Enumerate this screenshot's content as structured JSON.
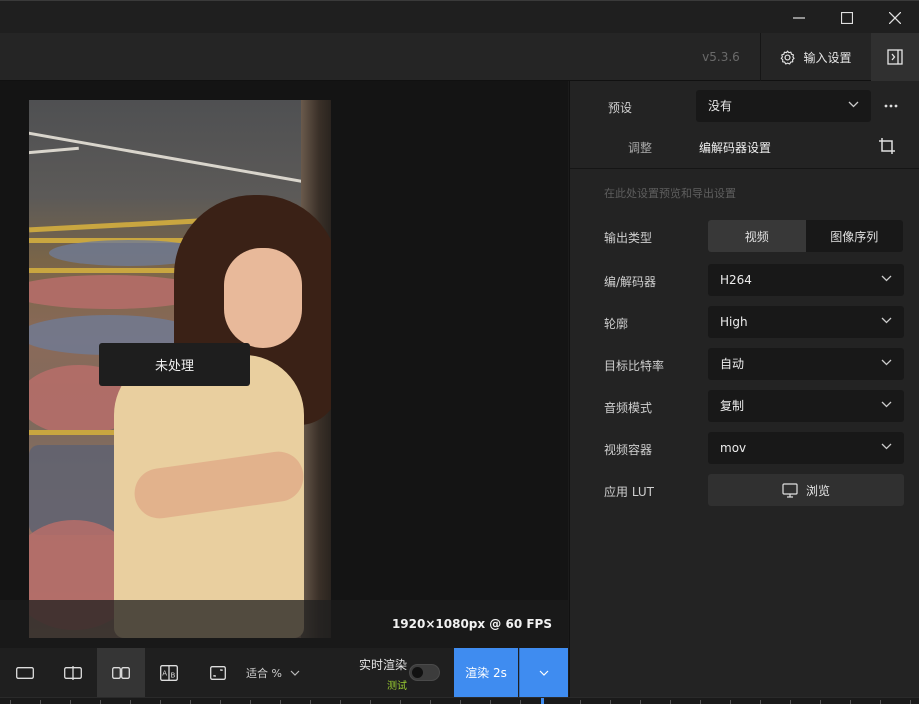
{
  "window": {
    "controls": [
      "minimize-icon",
      "maximize-icon",
      "close-icon"
    ]
  },
  "header": {
    "version": "v5.3.6",
    "input_settings_label": "输入设置",
    "icons": [
      "gear-icon",
      "panel-toggle-icon"
    ]
  },
  "preview": {
    "overlay_label": "未处理",
    "resolution": "1920×1080px @ 60 FPS"
  },
  "toolbar": {
    "fit_label": "适合 %",
    "realtime_label": "实时渲染",
    "realtime_sub": "测试",
    "realtime_enabled": false,
    "render_label": "渲染 2s",
    "accent_color": "#3f8cf0"
  },
  "panel": {
    "preset_label": "预设",
    "preset_value": "没有",
    "tabs": [
      {
        "label": "调整",
        "active": false
      },
      {
        "label": "编解码器设置",
        "active": true
      }
    ],
    "hint": "在此处设置预览和导出设置",
    "output_type_label": "输出类型",
    "output_type_options": [
      "视频",
      "图像序列"
    ],
    "output_type_selected": "视频",
    "codec_label": "编/解码器",
    "codec_value": "H264",
    "profile_label": "轮廓",
    "profile_value": "High",
    "bitrate_label": "目标比特率",
    "bitrate_value": "自动",
    "audio_label": "音频模式",
    "audio_value": "复制",
    "container_label": "视频容器",
    "container_value": "mov",
    "lut_label": "应用 LUT",
    "browse_label": "浏览"
  }
}
